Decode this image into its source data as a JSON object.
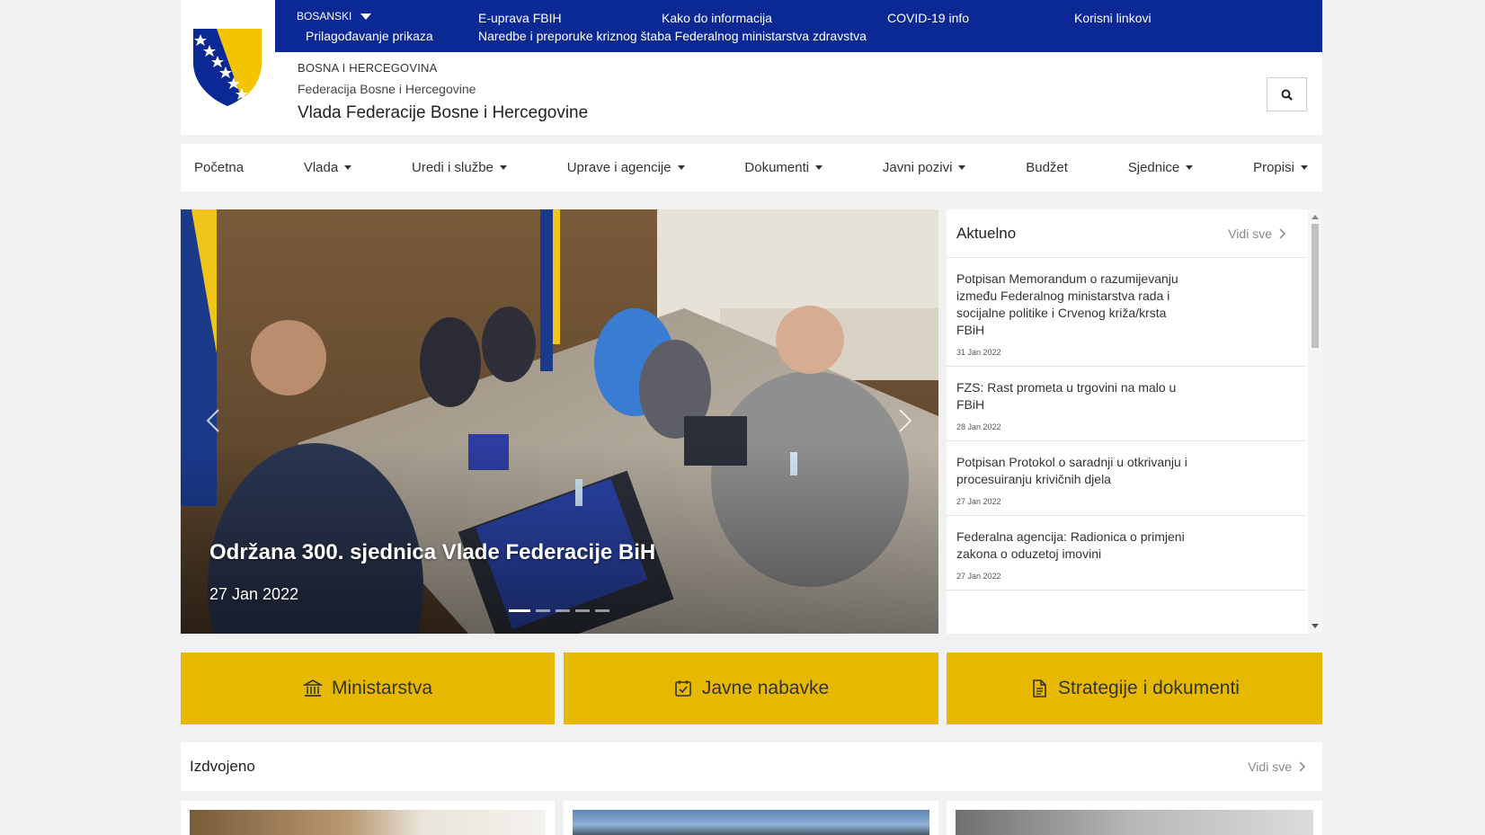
{
  "topbar": {
    "language": "BOSANSKI",
    "customize": "Prilagođavanje prikaza",
    "links": [
      "E-uprava FBIH",
      "Kako do informacija",
      "COVID-19 info",
      "Korisni linkovi"
    ],
    "announcement": "Naredbe i preporuke kriznog štaba Federalnog ministarstva zdravstva"
  },
  "header": {
    "country": "BOSNA I HERCEGOVINA",
    "entity": "Federacija Bosne i Hercegovine",
    "government": "Vlada Federacije Bosne i Hercegovine"
  },
  "nav": {
    "items": [
      {
        "label": "Početna"
      },
      {
        "label": "Vlada"
      },
      {
        "label": "Uredi i službe"
      },
      {
        "label": "Uprave i agencije"
      },
      {
        "label": "Dokumenti"
      },
      {
        "label": "Javni pozivi"
      },
      {
        "label": "Budžet"
      },
      {
        "label": "Sjednice"
      },
      {
        "label": "Propisi"
      }
    ]
  },
  "hero": {
    "caption": "Održana 300. sjednica Vlade Federacije BiH",
    "date": "27 Jan 2022",
    "slide_count": 5,
    "active_slide": 1
  },
  "news": {
    "title": "Aktuelno",
    "view_all": "Vidi sve",
    "items": [
      {
        "text": "Potpisan Memorandum o razumijevanju između Federalnog ministarstva rada i socijalne politike i Crvenog križa/krsta FBiH",
        "date": "31 Jan 2022"
      },
      {
        "text": "FZS: Rast prometa u trgovini na malo u FBiH",
        "date": "28 Jan 2022"
      },
      {
        "text": "Potpisan Protokol o saradnji u otkrivanju i procesuiranju krivičnih djela",
        "date": "27 Jan 2022"
      },
      {
        "text": "Federalna agencija: Radionica o primjeni zakona o oduzetoj imovini",
        "date": "27 Jan 2022"
      }
    ]
  },
  "tiles": {
    "ministries": "Ministarstva",
    "procurement": "Javne nabavke",
    "strategies": "Strategije i dokumenti"
  },
  "featured": {
    "title": "Izdvojeno",
    "view_all": "Vidi sve"
  },
  "colors": {
    "topbar": "#0a2994",
    "tile": "#e6b800",
    "background": "#f1f1f1"
  }
}
